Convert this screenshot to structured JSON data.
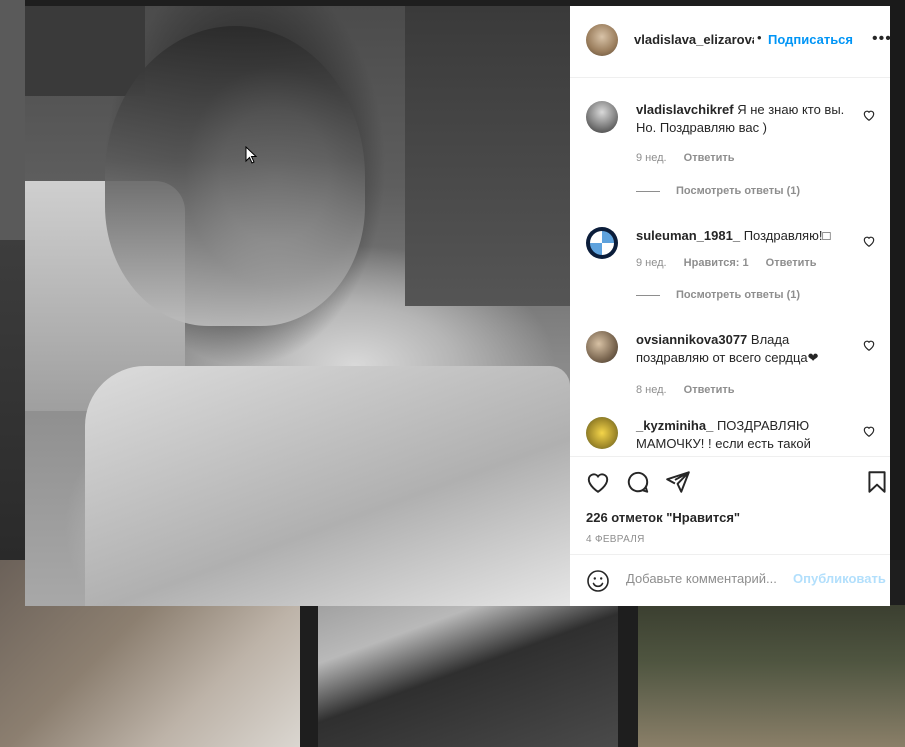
{
  "post": {
    "username": "vladislava_elizarova",
    "follow_label": "Подписаться",
    "dot": "•",
    "more": "•••"
  },
  "comments": [
    {
      "username": "vladislavchikref",
      "text": "Я не знаю кто вы. Но. Поздравляю вас )",
      "time": "9 нед.",
      "likes": "",
      "reply_label": "Ответить",
      "view_replies": "Посмотреть ответы (1)"
    },
    {
      "username": "suleuman_1981_",
      "text": "Поздравляю!□",
      "time": "9 нед.",
      "likes": "Нравится: 1",
      "reply_label": "Ответить",
      "view_replies": "Посмотреть ответы (1)"
    },
    {
      "username": "ovsiannikova3077",
      "text": "Влада поздравляю от всего сердца❤",
      "time": "8 нед.",
      "likes": "",
      "reply_label": "Ответить",
      "view_replies": ""
    },
    {
      "username": "_kyzminiha_",
      "text": "ПОЗДРАВЛЯЮ МАМОЧКУ! ! если есть такой",
      "time": "",
      "likes": "",
      "reply_label": "",
      "view_replies": ""
    }
  ],
  "actions": {
    "like_count": "226 отметок \"Нравится\"",
    "date": "4 февраля"
  },
  "add_comment": {
    "placeholder": "Добавьте комментарий...",
    "post_label": "Опубликовать"
  },
  "colors": {
    "link": "#0095f6",
    "post_disabled": "#b2dffc",
    "text": "#262626",
    "muted": "#8e8e8e"
  },
  "icons": {
    "like": "heart-icon",
    "comment": "comment-icon",
    "share": "paper-plane-icon",
    "save": "bookmark-icon",
    "emoji": "smiley-icon"
  }
}
